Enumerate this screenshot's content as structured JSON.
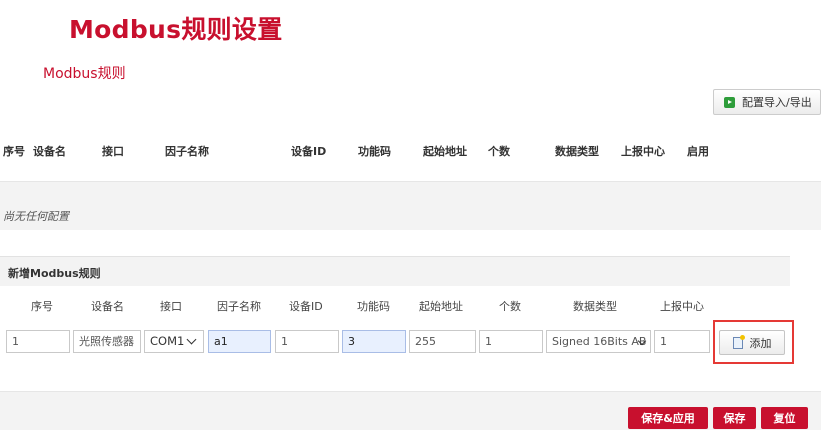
{
  "page": {
    "title": "Modbus规则设置",
    "section_title": "Modbus规则"
  },
  "toolbar": {
    "import_export_label": "配置导入/导出"
  },
  "table": {
    "headers": [
      "序号",
      "设备名",
      "接口",
      "因子名称",
      "设备ID",
      "功能码",
      "起始地址",
      "个数",
      "数据类型",
      "上报中心",
      "启用"
    ],
    "empty_text": "尚无任何配置"
  },
  "form": {
    "title": "新增Modbus规则",
    "labels": [
      "序号",
      "设备名",
      "接口",
      "因子名称",
      "设备ID",
      "功能码",
      "起始地址",
      "个数",
      "数据类型",
      "上报中心"
    ],
    "fields": {
      "index": "1",
      "device_name": "光照传感器",
      "interface": "COM1",
      "factor_name": "a1",
      "device_id": "1",
      "function_code": "3",
      "start_address": "255",
      "count": "1",
      "data_type": "Signed 16Bits AB",
      "report_center": "1"
    },
    "add_label": "添加"
  },
  "actions": {
    "save_apply": "保存&应用",
    "save": "保存",
    "reset": "复位"
  },
  "colors": {
    "accent": "#c8102e",
    "highlight_frame": "#e53935",
    "autofill_bg": "#e8f0fe"
  },
  "icons": {
    "import_export": "play-icon",
    "add": "document-add-icon",
    "dropdown": "chevron-down-icon"
  }
}
